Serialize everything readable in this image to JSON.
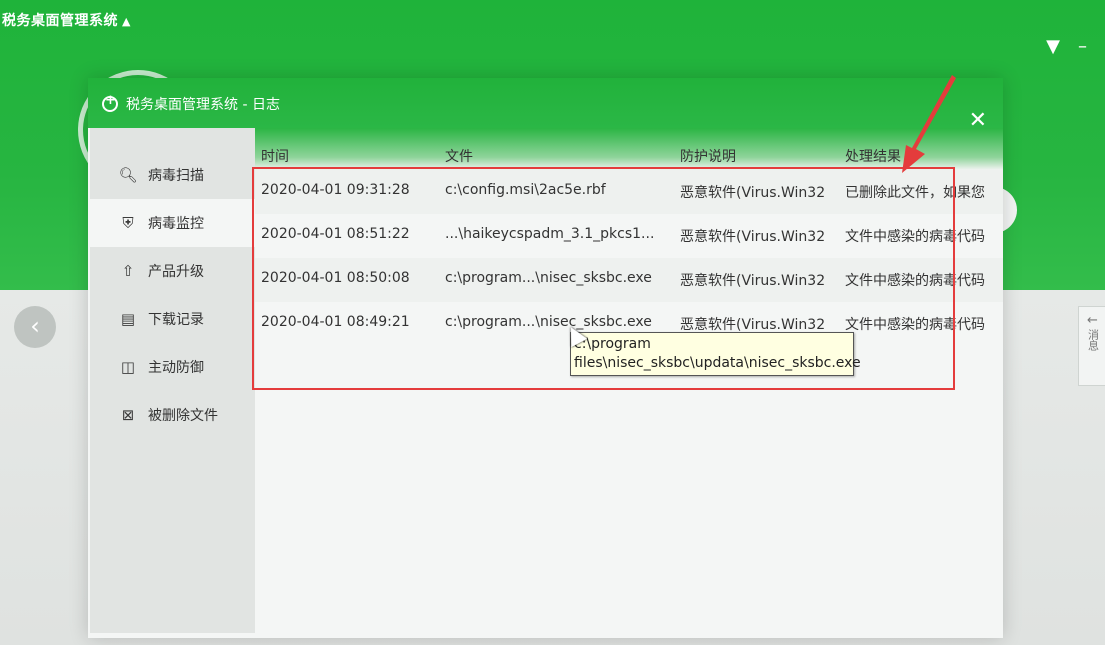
{
  "background": {
    "app_title": "税务桌面管理系统",
    "title_arrow": "▲",
    "window_controls": [
      "▼",
      "–"
    ],
    "message_tab_label": "消息",
    "prev_icon": "chevron-left-icon"
  },
  "dialog": {
    "title": "税务桌面管理系统 - 日志",
    "close_symbol": "✕",
    "sidebar": [
      {
        "label": "病毒扫描",
        "icon": "search-icon",
        "glyph": "🔍︎"
      },
      {
        "label": "病毒监控",
        "icon": "shield-icon",
        "glyph": "⛨"
      },
      {
        "label": "产品升级",
        "icon": "upload-icon",
        "glyph": "⇧"
      },
      {
        "label": "下载记录",
        "icon": "document-icon",
        "glyph": "▤"
      },
      {
        "label": "主动防御",
        "icon": "defense-icon",
        "glyph": "◫"
      },
      {
        "label": "被删除文件",
        "icon": "deleted-file-icon",
        "glyph": "⊠"
      }
    ],
    "table": {
      "headers": [
        "时间",
        "文件",
        "防护说明",
        "处理结果"
      ],
      "rows": [
        {
          "time": "2020-04-01 09:31:28",
          "file": "c:\\config.msi\\2ac5e.rbf",
          "desc": "恶意软件(Virus.Win32",
          "result": "已删除此文件，如果您"
        },
        {
          "time": "2020-04-01 08:51:22",
          "file": "...\\haikeycspadm_3.1_pkcs1...",
          "desc": "恶意软件(Virus.Win32",
          "result": "文件中感染的病毒代码"
        },
        {
          "time": "2020-04-01 08:50:08",
          "file": "c:\\program...\\nisec_sksbc.exe",
          "desc": "恶意软件(Virus.Win32",
          "result": "文件中感染的病毒代码"
        },
        {
          "time": "2020-04-01 08:49:21",
          "file": "c:\\program...\\nisec_sksbc.exe",
          "desc": "恶意软件(Virus.Win32",
          "result": "文件中感染的病毒代码"
        }
      ]
    },
    "tooltip": "c:\\program files\\nisec_sksbc\\updata\\nisec_sksbc.exe"
  },
  "colors": {
    "brand_green": "#22b33c",
    "annotation_red": "#e43c3c",
    "tooltip_bg": "#ffffe1"
  }
}
